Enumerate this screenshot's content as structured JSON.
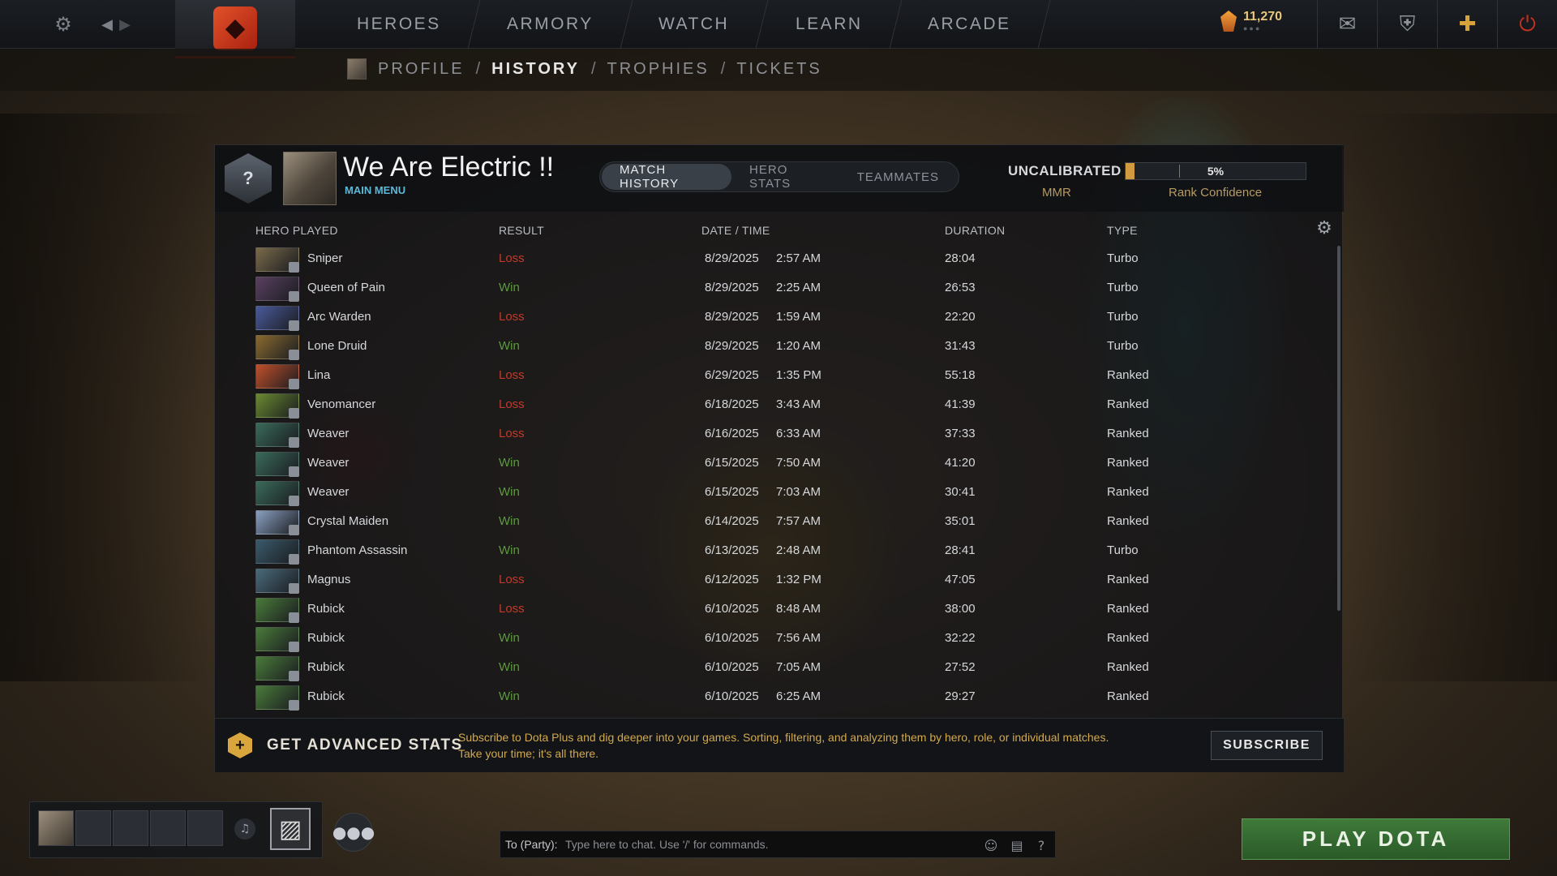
{
  "topbar": {
    "nav": [
      "HEROES",
      "ARMORY",
      "WATCH",
      "LEARN",
      "ARCADE"
    ],
    "shards": "11,270"
  },
  "subnav": {
    "crumbs": [
      "PROFILE",
      "HISTORY",
      "TROPHIES",
      "TICKETS"
    ],
    "active": "HISTORY"
  },
  "profile": {
    "rank_glyph": "?",
    "name": "We Are Electric !!",
    "status": "MAIN MENU"
  },
  "tabs": [
    "MATCH HISTORY",
    "HERO STATS",
    "TEAMMATES"
  ],
  "mmr": {
    "label": "UNCALIBRATED",
    "sub": "MMR",
    "confidence_text": "5%",
    "confidence_value": 0.05,
    "confidence_label": "Rank Confidence"
  },
  "columns": [
    "HERO PLAYED",
    "RESULT",
    "DATE / TIME",
    "DURATION",
    "TYPE"
  ],
  "matches": [
    {
      "hero": "Sniper",
      "result": "Loss",
      "date": "8/29/2025",
      "time": "2:57 AM",
      "duration": "28:04",
      "type": "Turbo",
      "color": "#7a6a4a"
    },
    {
      "hero": "Queen of Pain",
      "result": "Win",
      "date": "8/29/2025",
      "time": "2:25 AM",
      "duration": "26:53",
      "type": "Turbo",
      "color": "#5a4060"
    },
    {
      "hero": "Arc Warden",
      "result": "Loss",
      "date": "8/29/2025",
      "time": "1:59 AM",
      "duration": "22:20",
      "type": "Turbo",
      "color": "#4a5a9a"
    },
    {
      "hero": "Lone Druid",
      "result": "Win",
      "date": "8/29/2025",
      "time": "1:20 AM",
      "duration": "31:43",
      "type": "Turbo",
      "color": "#8a6a30"
    },
    {
      "hero": "Lina",
      "result": "Loss",
      "date": "6/29/2025",
      "time": "1:35 PM",
      "duration": "55:18",
      "type": "Ranked",
      "color": "#c0502a"
    },
    {
      "hero": "Venomancer",
      "result": "Loss",
      "date": "6/18/2025",
      "time": "3:43 AM",
      "duration": "41:39",
      "type": "Ranked",
      "color": "#6a8a30"
    },
    {
      "hero": "Weaver",
      "result": "Loss",
      "date": "6/16/2025",
      "time": "6:33 AM",
      "duration": "37:33",
      "type": "Ranked",
      "color": "#3a6a5a"
    },
    {
      "hero": "Weaver",
      "result": "Win",
      "date": "6/15/2025",
      "time": "7:50 AM",
      "duration": "41:20",
      "type": "Ranked",
      "color": "#3a6a5a"
    },
    {
      "hero": "Weaver",
      "result": "Win",
      "date": "6/15/2025",
      "time": "7:03 AM",
      "duration": "30:41",
      "type": "Ranked",
      "color": "#3a6a5a"
    },
    {
      "hero": "Crystal Maiden",
      "result": "Win",
      "date": "6/14/2025",
      "time": "7:57 AM",
      "duration": "35:01",
      "type": "Ranked",
      "color": "#8aa0c0"
    },
    {
      "hero": "Phantom Assassin",
      "result": "Win",
      "date": "6/13/2025",
      "time": "2:48 AM",
      "duration": "28:41",
      "type": "Turbo",
      "color": "#3a5a6a"
    },
    {
      "hero": "Magnus",
      "result": "Loss",
      "date": "6/12/2025",
      "time": "1:32 PM",
      "duration": "47:05",
      "type": "Ranked",
      "color": "#4a6a7a"
    },
    {
      "hero": "Rubick",
      "result": "Loss",
      "date": "6/10/2025",
      "time": "8:48 AM",
      "duration": "38:00",
      "type": "Ranked",
      "color": "#4a7a3a"
    },
    {
      "hero": "Rubick",
      "result": "Win",
      "date": "6/10/2025",
      "time": "7:56 AM",
      "duration": "32:22",
      "type": "Ranked",
      "color": "#4a7a3a"
    },
    {
      "hero": "Rubick",
      "result": "Win",
      "date": "6/10/2025",
      "time": "7:05 AM",
      "duration": "27:52",
      "type": "Ranked",
      "color": "#4a7a3a"
    },
    {
      "hero": "Rubick",
      "result": "Win",
      "date": "6/10/2025",
      "time": "6:25 AM",
      "duration": "29:27",
      "type": "Ranked",
      "color": "#4a7a3a"
    }
  ],
  "promo": {
    "title": "GET ADVANCED STATS",
    "text": "Subscribe to Dota Plus and dig deeper into your games. Sorting, filtering, and analyzing them by hero, role, or individual matches. Take your time; it's all there.",
    "button": "SUBSCRIBE"
  },
  "chat": {
    "label": "To (Party):",
    "placeholder": "Type here to chat. Use '/' for commands."
  },
  "play_button": "PLAY DOTA",
  "colors": {
    "win": "#5d9a3f",
    "loss": "#c33a2a",
    "accent": "#d29a3e",
    "play": "#3f7a3a"
  }
}
